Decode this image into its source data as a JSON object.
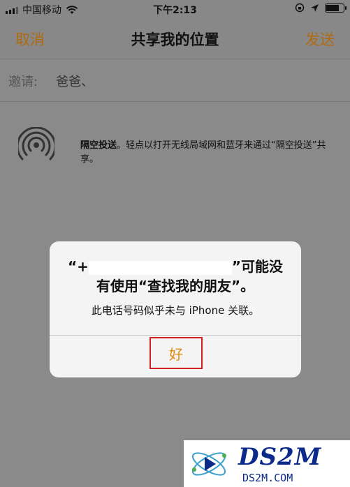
{
  "status_bar": {
    "carrier": "中国移动",
    "time": "下午2:13",
    "battery_level": 0.7
  },
  "nav": {
    "cancel_label": "取消",
    "title": "共享我的位置",
    "send_label": "发送"
  },
  "invite": {
    "label": "邀请:",
    "value": "爸爸、"
  },
  "airdrop": {
    "title": "隔空投送",
    "description": "。轻点以打开无线局域网和蓝牙来通过“隔空投送”共享。"
  },
  "alert": {
    "title_prefix": "“+",
    "title_suffix": "”可能没",
    "title_line2": "有使用“查找我的朋友”。",
    "message": "此电话号码似乎未与 iPhone 关联。",
    "ok_label": "好"
  },
  "watermark": {
    "brand": "DS2M",
    "domain": "DS2M.COM"
  },
  "colors": {
    "accent_orange": "#e08a10",
    "highlight_red": "#d32020",
    "watermark_blue": "#0b2a8a"
  }
}
